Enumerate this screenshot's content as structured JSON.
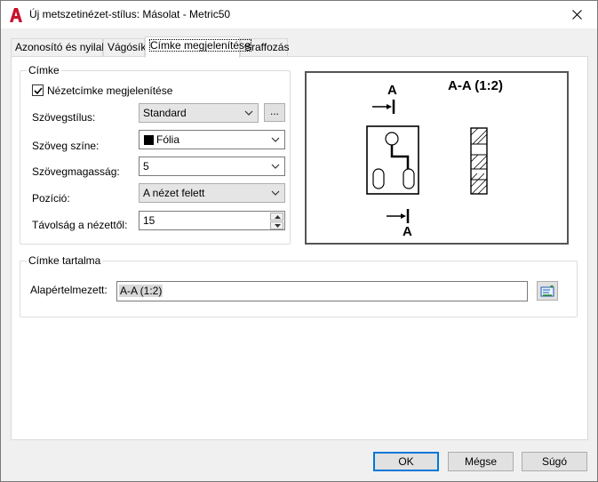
{
  "window": {
    "title": "Új metszetinézet-stílus: Másolat - Metric50"
  },
  "tabs": [
    {
      "label": "Azonosító és nyilak",
      "active": false
    },
    {
      "label": "Vágósík",
      "active": false
    },
    {
      "label": "Címke megjelenítése",
      "active": true
    },
    {
      "label": "Sraffozás",
      "active": false
    }
  ],
  "label_group": {
    "legend": "Címke",
    "show_checkbox_label": "Nézetcímke megjelenítése",
    "show_checked": true,
    "text_style_label": "Szövegstílus:",
    "text_style_value": "Standard",
    "browse_label": "...",
    "text_color_label": "Szöveg színe:",
    "text_color_value": "Fólia",
    "text_color_swatch": "#000000",
    "text_height_label": "Szövegmagasság:",
    "text_height_value": "5",
    "position_label": "Pozíció:",
    "position_value": "A nézet felett",
    "distance_label": "Távolság a nézettől:",
    "distance_value": "15"
  },
  "preview": {
    "title": "A-A (1:2)",
    "marker_top": "A",
    "marker_bottom": "A"
  },
  "content_group": {
    "legend": "Címke tartalma",
    "default_label": "Alapértelmezett:",
    "default_value": "A-A (1:2)"
  },
  "buttons": {
    "ok": "OK",
    "cancel": "Mégse",
    "help": "Súgó"
  },
  "colors": {
    "accent": "#0078d7",
    "app_icon": "#c8102e"
  }
}
